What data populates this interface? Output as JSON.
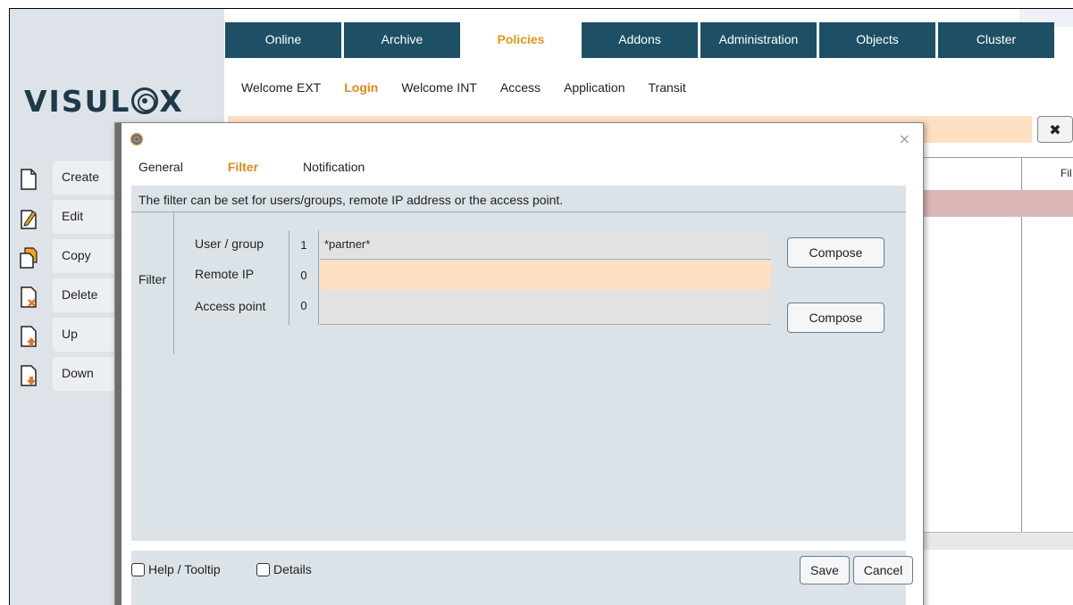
{
  "brand": {
    "logo_prefix": "VISUL",
    "logo_suffix": "X"
  },
  "topnav": {
    "tabs": [
      {
        "label": "Online"
      },
      {
        "label": "Archive"
      },
      {
        "label": "Policies"
      },
      {
        "label": "Addons"
      },
      {
        "label": "Administration"
      },
      {
        "label": "Objects"
      },
      {
        "label": "Cluster"
      }
    ],
    "active_index": 2
  },
  "subnav": {
    "items": [
      {
        "label": "Welcome EXT"
      },
      {
        "label": "Login"
      },
      {
        "label": "Welcome INT"
      },
      {
        "label": "Access"
      },
      {
        "label": "Application"
      },
      {
        "label": "Transit"
      }
    ],
    "active_index": 1
  },
  "actions": [
    {
      "label": "Create",
      "icon": "document-icon"
    },
    {
      "label": "Edit",
      "icon": "edit-document-icon"
    },
    {
      "label": "Copy",
      "icon": "copy-document-icon"
    },
    {
      "label": "Delete",
      "icon": "delete-document-icon"
    },
    {
      "label": "Up",
      "icon": "move-up-icon"
    },
    {
      "label": "Down",
      "icon": "move-down-icon"
    }
  ],
  "background": {
    "column_header_partial": "Fil",
    "close_glyph": "✖"
  },
  "dialog": {
    "close_glyph": "×",
    "tabs": [
      {
        "label": "General"
      },
      {
        "label": "Filter"
      },
      {
        "label": "Notification"
      }
    ],
    "active_tab": 1,
    "info": "The filter can be set for users/groups, remote IP address or the access point.",
    "filter": {
      "group_label": "Filter",
      "rows": [
        {
          "label": "User / group",
          "count": "1",
          "value": "*partner*",
          "compose": "Compose"
        },
        {
          "label": "Remote IP",
          "count": "0",
          "value": "",
          "compose": ""
        },
        {
          "label": "Access point",
          "count": "0",
          "value": "",
          "compose": "Compose"
        }
      ]
    },
    "footer": {
      "help": "Help / Tooltip",
      "details": "Details",
      "save": "Save",
      "cancel": "Cancel"
    }
  },
  "colors": {
    "nav_bg": "#1e5065",
    "accent": "#e08a18",
    "highlight_field": "#fde0c1",
    "panel_bg": "#dbe3e8"
  }
}
